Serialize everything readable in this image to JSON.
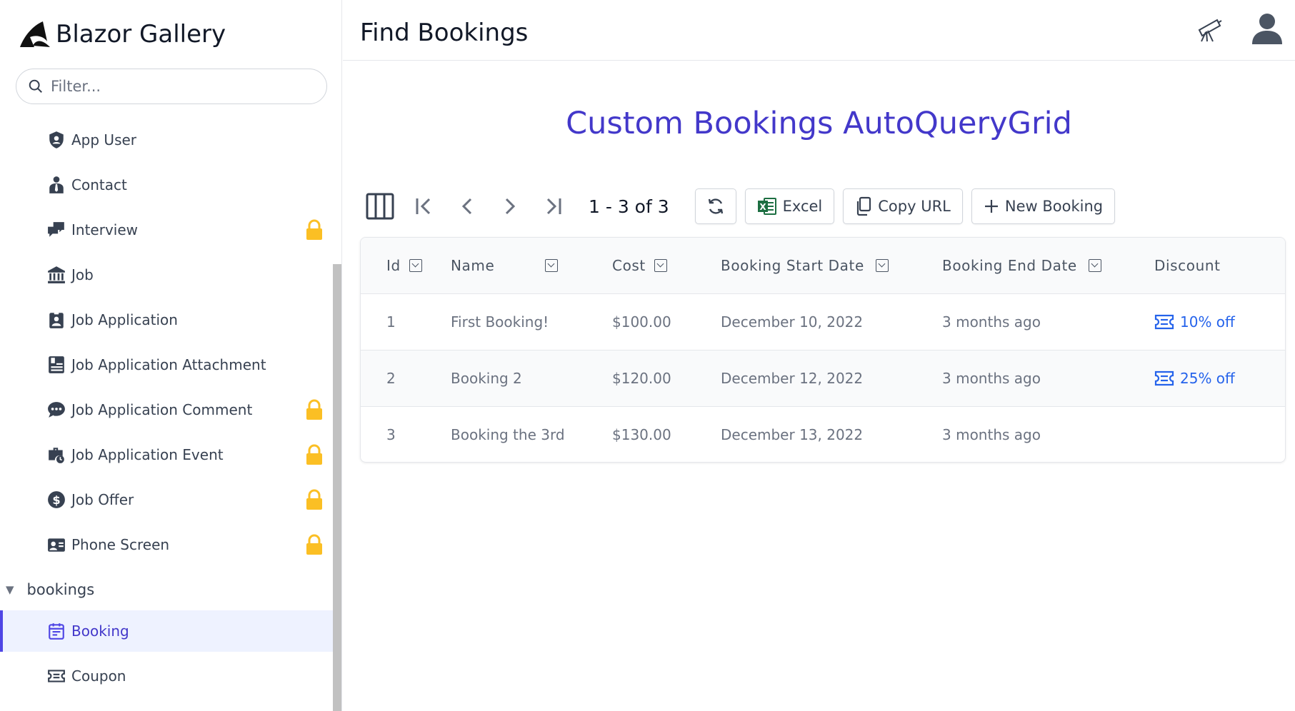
{
  "sidebar": {
    "brand": "Blazor Gallery",
    "filter_placeholder": "Filter...",
    "items": [
      {
        "label": "App User",
        "icon": "shield-user-icon",
        "locked": false
      },
      {
        "label": "Contact",
        "icon": "person-tie-icon",
        "locked": false
      },
      {
        "label": "Interview",
        "icon": "chat-bubbles-icon",
        "locked": true
      },
      {
        "label": "Job",
        "icon": "bank-icon",
        "locked": false
      },
      {
        "label": "Job Application",
        "icon": "id-badge-icon",
        "locked": false
      },
      {
        "label": "Job Application Attachment",
        "icon": "attachment-list-icon",
        "locked": false
      },
      {
        "label": "Job Application Comment",
        "icon": "comment-dots-icon",
        "locked": true
      },
      {
        "label": "Job Application Event",
        "icon": "briefcase-clock-icon",
        "locked": true
      },
      {
        "label": "Job Offer",
        "icon": "dollar-circle-icon",
        "locked": true
      },
      {
        "label": "Phone Screen",
        "icon": "contact-card-icon",
        "locked": false
      }
    ],
    "group": "bookings",
    "group_items": [
      {
        "label": "Booking",
        "icon": "calendar-icon",
        "active": true
      },
      {
        "label": "Coupon",
        "icon": "ticket-icon",
        "active": false
      }
    ]
  },
  "header": {
    "title": "Find Bookings"
  },
  "grid": {
    "title": "Custom Bookings AutoQueryGrid",
    "pager_text": "1 - 3 of 3",
    "buttons": {
      "excel": "Excel",
      "copy_url": "Copy URL",
      "new": "New Booking"
    },
    "columns": [
      "Id",
      "Name",
      "Cost",
      "Booking Start Date",
      "Booking End Date",
      "Discount"
    ],
    "rows": [
      {
        "id": "1",
        "name": "First Booking!",
        "cost": "$100.00",
        "start": "December 10, 2022",
        "end": "3 months ago",
        "discount": "10% off"
      },
      {
        "id": "2",
        "name": "Booking 2",
        "cost": "$120.00",
        "start": "December 12, 2022",
        "end": "3 months ago",
        "discount": "25% off"
      },
      {
        "id": "3",
        "name": "Booking the 3rd",
        "cost": "$130.00",
        "start": "December 13, 2022",
        "end": "3 months ago",
        "discount": ""
      }
    ]
  },
  "colors": {
    "accent": "#4338ca",
    "link": "#2563eb",
    "lock": "#fbbf24"
  }
}
